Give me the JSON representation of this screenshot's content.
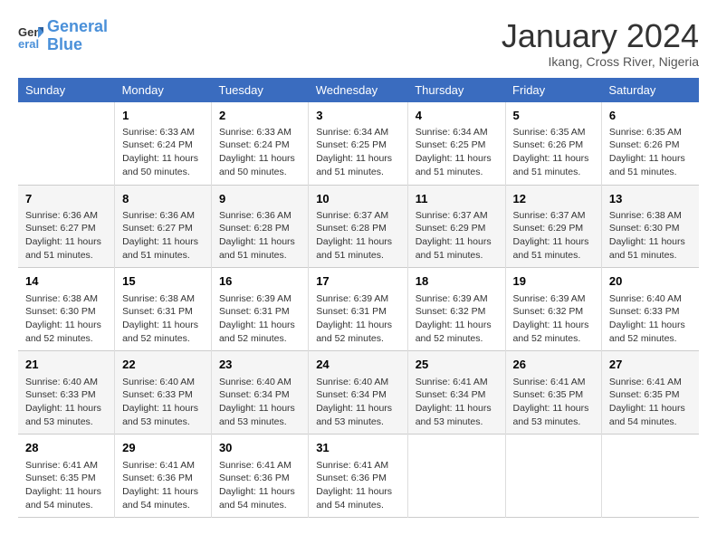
{
  "logo": {
    "line1": "General",
    "line2": "Blue"
  },
  "title": "January 2024",
  "subtitle": "Ikang, Cross River, Nigeria",
  "days": [
    "Sunday",
    "Monday",
    "Tuesday",
    "Wednesday",
    "Thursday",
    "Friday",
    "Saturday"
  ],
  "weeks": [
    [
      {
        "day": "",
        "content": ""
      },
      {
        "day": "1",
        "content": "Sunrise: 6:33 AM\nSunset: 6:24 PM\nDaylight: 11 hours\nand 50 minutes."
      },
      {
        "day": "2",
        "content": "Sunrise: 6:33 AM\nSunset: 6:24 PM\nDaylight: 11 hours\nand 50 minutes."
      },
      {
        "day": "3",
        "content": "Sunrise: 6:34 AM\nSunset: 6:25 PM\nDaylight: 11 hours\nand 51 minutes."
      },
      {
        "day": "4",
        "content": "Sunrise: 6:34 AM\nSunset: 6:25 PM\nDaylight: 11 hours\nand 51 minutes."
      },
      {
        "day": "5",
        "content": "Sunrise: 6:35 AM\nSunset: 6:26 PM\nDaylight: 11 hours\nand 51 minutes."
      },
      {
        "day": "6",
        "content": "Sunrise: 6:35 AM\nSunset: 6:26 PM\nDaylight: 11 hours\nand 51 minutes."
      }
    ],
    [
      {
        "day": "7",
        "content": "Sunrise: 6:36 AM\nSunset: 6:27 PM\nDaylight: 11 hours\nand 51 minutes."
      },
      {
        "day": "8",
        "content": "Sunrise: 6:36 AM\nSunset: 6:27 PM\nDaylight: 11 hours\nand 51 minutes."
      },
      {
        "day": "9",
        "content": "Sunrise: 6:36 AM\nSunset: 6:28 PM\nDaylight: 11 hours\nand 51 minutes."
      },
      {
        "day": "10",
        "content": "Sunrise: 6:37 AM\nSunset: 6:28 PM\nDaylight: 11 hours\nand 51 minutes."
      },
      {
        "day": "11",
        "content": "Sunrise: 6:37 AM\nSunset: 6:29 PM\nDaylight: 11 hours\nand 51 minutes."
      },
      {
        "day": "12",
        "content": "Sunrise: 6:37 AM\nSunset: 6:29 PM\nDaylight: 11 hours\nand 51 minutes."
      },
      {
        "day": "13",
        "content": "Sunrise: 6:38 AM\nSunset: 6:30 PM\nDaylight: 11 hours\nand 51 minutes."
      }
    ],
    [
      {
        "day": "14",
        "content": "Sunrise: 6:38 AM\nSunset: 6:30 PM\nDaylight: 11 hours\nand 52 minutes."
      },
      {
        "day": "15",
        "content": "Sunrise: 6:38 AM\nSunset: 6:31 PM\nDaylight: 11 hours\nand 52 minutes."
      },
      {
        "day": "16",
        "content": "Sunrise: 6:39 AM\nSunset: 6:31 PM\nDaylight: 11 hours\nand 52 minutes."
      },
      {
        "day": "17",
        "content": "Sunrise: 6:39 AM\nSunset: 6:31 PM\nDaylight: 11 hours\nand 52 minutes."
      },
      {
        "day": "18",
        "content": "Sunrise: 6:39 AM\nSunset: 6:32 PM\nDaylight: 11 hours\nand 52 minutes."
      },
      {
        "day": "19",
        "content": "Sunrise: 6:39 AM\nSunset: 6:32 PM\nDaylight: 11 hours\nand 52 minutes."
      },
      {
        "day": "20",
        "content": "Sunrise: 6:40 AM\nSunset: 6:33 PM\nDaylight: 11 hours\nand 52 minutes."
      }
    ],
    [
      {
        "day": "21",
        "content": "Sunrise: 6:40 AM\nSunset: 6:33 PM\nDaylight: 11 hours\nand 53 minutes."
      },
      {
        "day": "22",
        "content": "Sunrise: 6:40 AM\nSunset: 6:33 PM\nDaylight: 11 hours\nand 53 minutes."
      },
      {
        "day": "23",
        "content": "Sunrise: 6:40 AM\nSunset: 6:34 PM\nDaylight: 11 hours\nand 53 minutes."
      },
      {
        "day": "24",
        "content": "Sunrise: 6:40 AM\nSunset: 6:34 PM\nDaylight: 11 hours\nand 53 minutes."
      },
      {
        "day": "25",
        "content": "Sunrise: 6:41 AM\nSunset: 6:34 PM\nDaylight: 11 hours\nand 53 minutes."
      },
      {
        "day": "26",
        "content": "Sunrise: 6:41 AM\nSunset: 6:35 PM\nDaylight: 11 hours\nand 53 minutes."
      },
      {
        "day": "27",
        "content": "Sunrise: 6:41 AM\nSunset: 6:35 PM\nDaylight: 11 hours\nand 54 minutes."
      }
    ],
    [
      {
        "day": "28",
        "content": "Sunrise: 6:41 AM\nSunset: 6:35 PM\nDaylight: 11 hours\nand 54 minutes."
      },
      {
        "day": "29",
        "content": "Sunrise: 6:41 AM\nSunset: 6:36 PM\nDaylight: 11 hours\nand 54 minutes."
      },
      {
        "day": "30",
        "content": "Sunrise: 6:41 AM\nSunset: 6:36 PM\nDaylight: 11 hours\nand 54 minutes."
      },
      {
        "day": "31",
        "content": "Sunrise: 6:41 AM\nSunset: 6:36 PM\nDaylight: 11 hours\nand 54 minutes."
      },
      {
        "day": "",
        "content": ""
      },
      {
        "day": "",
        "content": ""
      },
      {
        "day": "",
        "content": ""
      }
    ]
  ]
}
